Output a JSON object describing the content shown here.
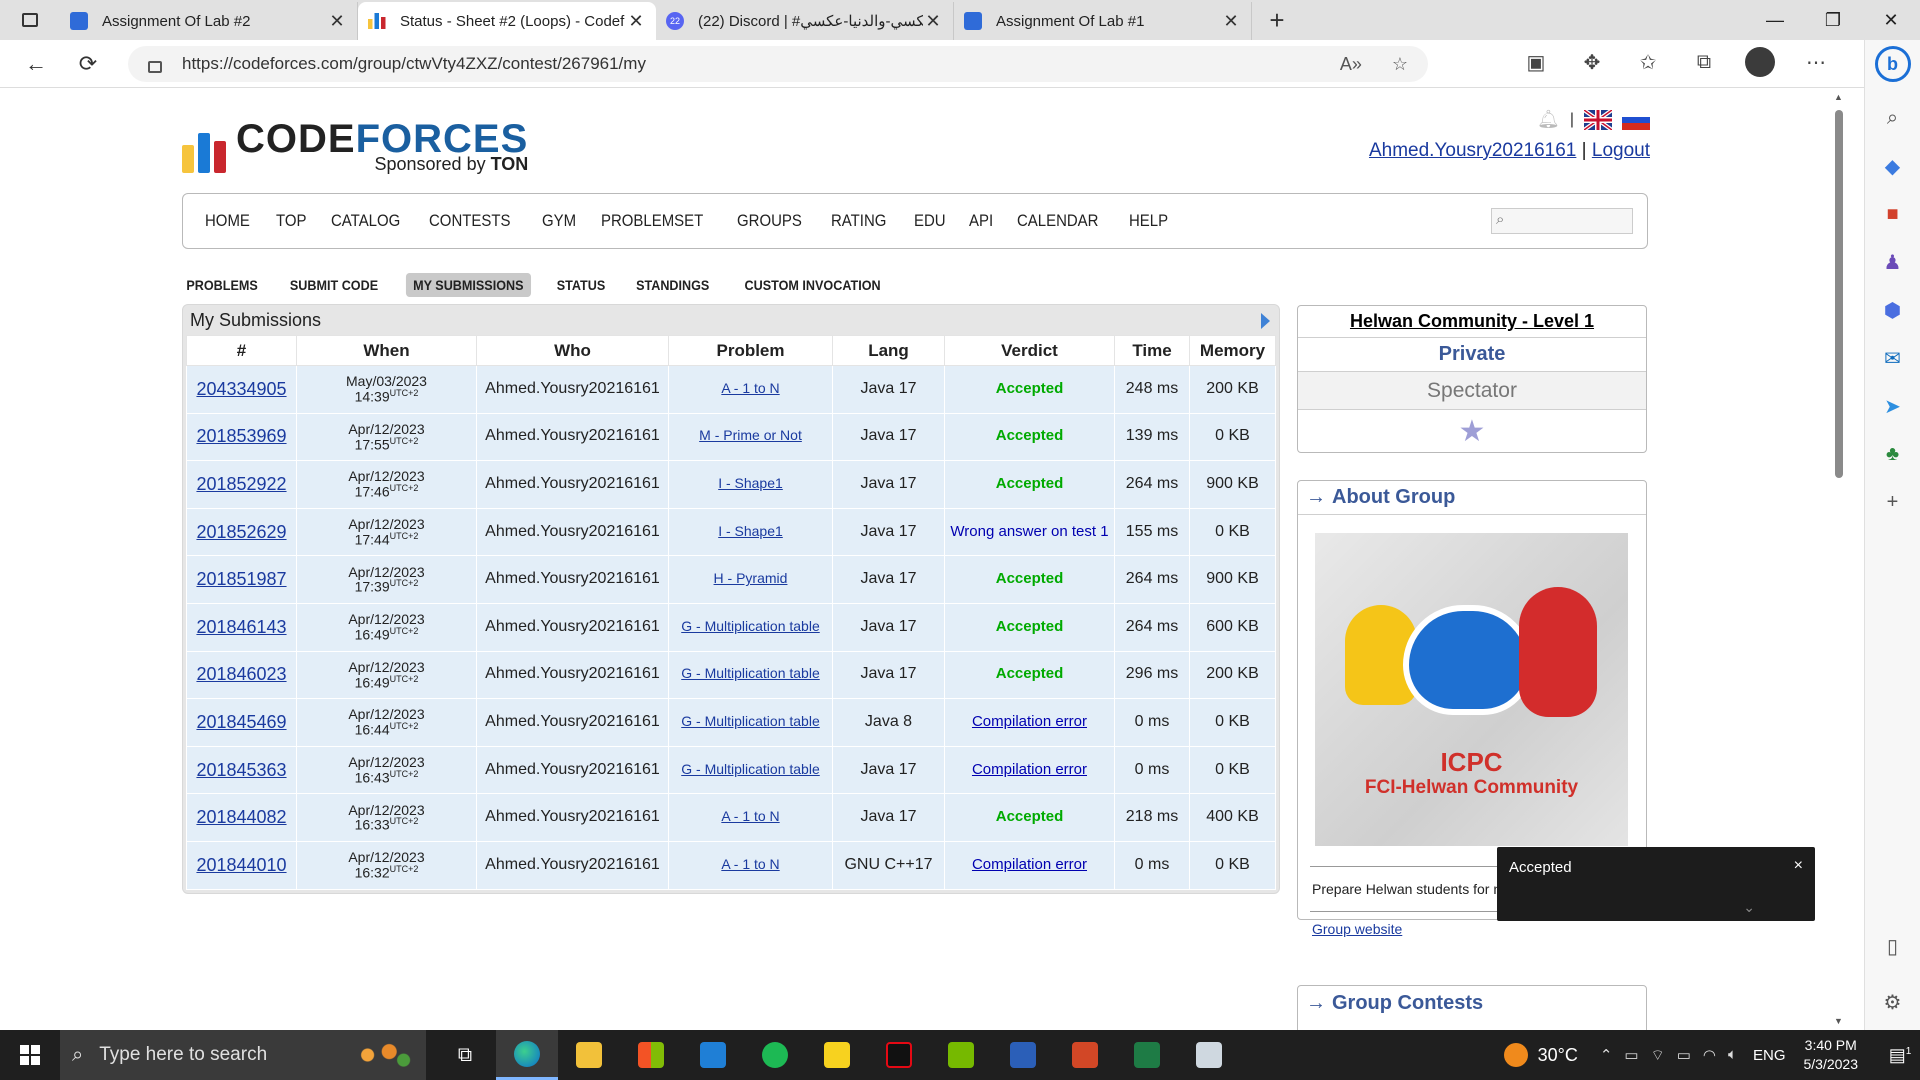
{
  "browser": {
    "tabs": [
      {
        "title": "Assignment Of Lab #2",
        "active": false,
        "icon": "user-card-icon"
      },
      {
        "title": "Status - Sheet #2 (Loops) - Codef",
        "active": true,
        "icon": "codeforces-icon"
      },
      {
        "title": "(22) Discord | #عكسي-والدنيا-عكسي",
        "active": false,
        "icon": "discord-icon",
        "badge": "22"
      },
      {
        "title": "Assignment Of Lab #1",
        "active": false,
        "icon": "user-card-icon"
      }
    ],
    "url": "https://codeforces.com/group/ctwVty4ZXZ/contest/267961/my"
  },
  "site": {
    "logo_code": "CODE",
    "logo_forces": "FORCES",
    "sponsor_prefix": "Sponsored by",
    "sponsor_name": "TON",
    "username": "Ahmed.Yousry20216161",
    "separator": "|",
    "logout": "Logout",
    "menu": [
      "HOME",
      "TOP",
      "CATALOG",
      "CONTESTS",
      "GYM",
      "PROBLEMSET",
      "GROUPS",
      "RATING",
      "EDU",
      "API",
      "CALENDAR",
      "HELP"
    ],
    "submenu": [
      "PROBLEMS",
      "SUBMIT CODE",
      "MY SUBMISSIONS",
      "STATUS",
      "STANDINGS",
      "CUSTOM INVOCATION"
    ],
    "submenu_current": "MY SUBMISSIONS"
  },
  "submissions": {
    "caption": "My Submissions",
    "headers": [
      "#",
      "When",
      "Who",
      "Problem",
      "Lang",
      "Verdict",
      "Time",
      "Memory"
    ],
    "tz": "UTC+2",
    "rows": [
      {
        "id": "204334905",
        "date": "May/03/2023",
        "time": "14:39",
        "who": "Ahmed.Yousry20216161",
        "problem": "A - 1 to N",
        "lang": "Java 17",
        "verdict": "Accepted",
        "vclass": "ok",
        "t": "248 ms",
        "mem": "200 KB"
      },
      {
        "id": "201853969",
        "date": "Apr/12/2023",
        "time": "17:55",
        "who": "Ahmed.Yousry20216161",
        "problem": "M - Prime or Not",
        "lang": "Java 17",
        "verdict": "Accepted",
        "vclass": "ok",
        "t": "139 ms",
        "mem": "0 KB"
      },
      {
        "id": "201852922",
        "date": "Apr/12/2023",
        "time": "17:46",
        "who": "Ahmed.Yousry20216161",
        "problem": "I - Shape1",
        "lang": "Java 17",
        "verdict": "Accepted",
        "vclass": "ok",
        "t": "264 ms",
        "mem": "900 KB"
      },
      {
        "id": "201852629",
        "date": "Apr/12/2023",
        "time": "17:44",
        "who": "Ahmed.Yousry20216161",
        "problem": "I - Shape1",
        "lang": "Java 17",
        "verdict": "Wrong answer on test 1",
        "vclass": "wa",
        "t": "155 ms",
        "mem": "0 KB"
      },
      {
        "id": "201851987",
        "date": "Apr/12/2023",
        "time": "17:39",
        "who": "Ahmed.Yousry20216161",
        "problem": "H - Pyramid",
        "lang": "Java 17",
        "verdict": "Accepted",
        "vclass": "ok",
        "t": "264 ms",
        "mem": "900 KB"
      },
      {
        "id": "201846143",
        "date": "Apr/12/2023",
        "time": "16:49",
        "who": "Ahmed.Yousry20216161",
        "problem": "G - Multiplication table",
        "lang": "Java 17",
        "verdict": "Accepted",
        "vclass": "ok",
        "t": "264 ms",
        "mem": "600 KB"
      },
      {
        "id": "201846023",
        "date": "Apr/12/2023",
        "time": "16:49",
        "who": "Ahmed.Yousry20216161",
        "problem": "G - Multiplication table",
        "lang": "Java 17",
        "verdict": "Accepted",
        "vclass": "ok",
        "t": "296 ms",
        "mem": "200 KB"
      },
      {
        "id": "201845469",
        "date": "Apr/12/2023",
        "time": "16:44",
        "who": "Ahmed.Yousry20216161",
        "problem": "G - Multiplication table",
        "lang": "Java 8",
        "verdict": "Compilation error",
        "vclass": "ce",
        "t": "0 ms",
        "mem": "0 KB"
      },
      {
        "id": "201845363",
        "date": "Apr/12/2023",
        "time": "16:43",
        "who": "Ahmed.Yousry20216161",
        "problem": "G - Multiplication table",
        "lang": "Java 17",
        "verdict": "Compilation error",
        "vclass": "ce",
        "t": "0 ms",
        "mem": "0 KB"
      },
      {
        "id": "201844082",
        "date": "Apr/12/2023",
        "time": "16:33",
        "who": "Ahmed.Yousry20216161",
        "problem": "A - 1 to N",
        "lang": "Java 17",
        "verdict": "Accepted",
        "vclass": "ok",
        "t": "218 ms",
        "mem": "400 KB"
      },
      {
        "id": "201844010",
        "date": "Apr/12/2023",
        "time": "16:32",
        "who": "Ahmed.Yousry20216161",
        "problem": "A - 1 to N",
        "lang": "GNU C++17",
        "verdict": "Compilation error",
        "vclass": "ce",
        "t": "0 ms",
        "mem": "0 KB"
      }
    ]
  },
  "sidebar": {
    "contest_name": "Helwan Community - Level 1",
    "visibility": "Private",
    "role": "Spectator",
    "about_title": "About Group",
    "about_arrow": "→",
    "image_text_1": "ICPC",
    "image_text_2": "FCI-Helwan Community",
    "description": "Prepare Helwan students for next ICPCs",
    "group_website": "Group website",
    "contests_title": "Group Contests"
  },
  "toast": {
    "text": "Accepted",
    "close": "×"
  },
  "taskbar": {
    "search_placeholder": "Type here to search",
    "temperature": "30°C",
    "language": "ENG",
    "time": "3:40 PM",
    "date": "5/3/2023",
    "notifications": "1"
  },
  "colors": {
    "codeforces_blue": "#1a5fa0",
    "link": "#1a3a9f",
    "accepted": "#00aa00",
    "row_bg": "#e3eef8"
  }
}
